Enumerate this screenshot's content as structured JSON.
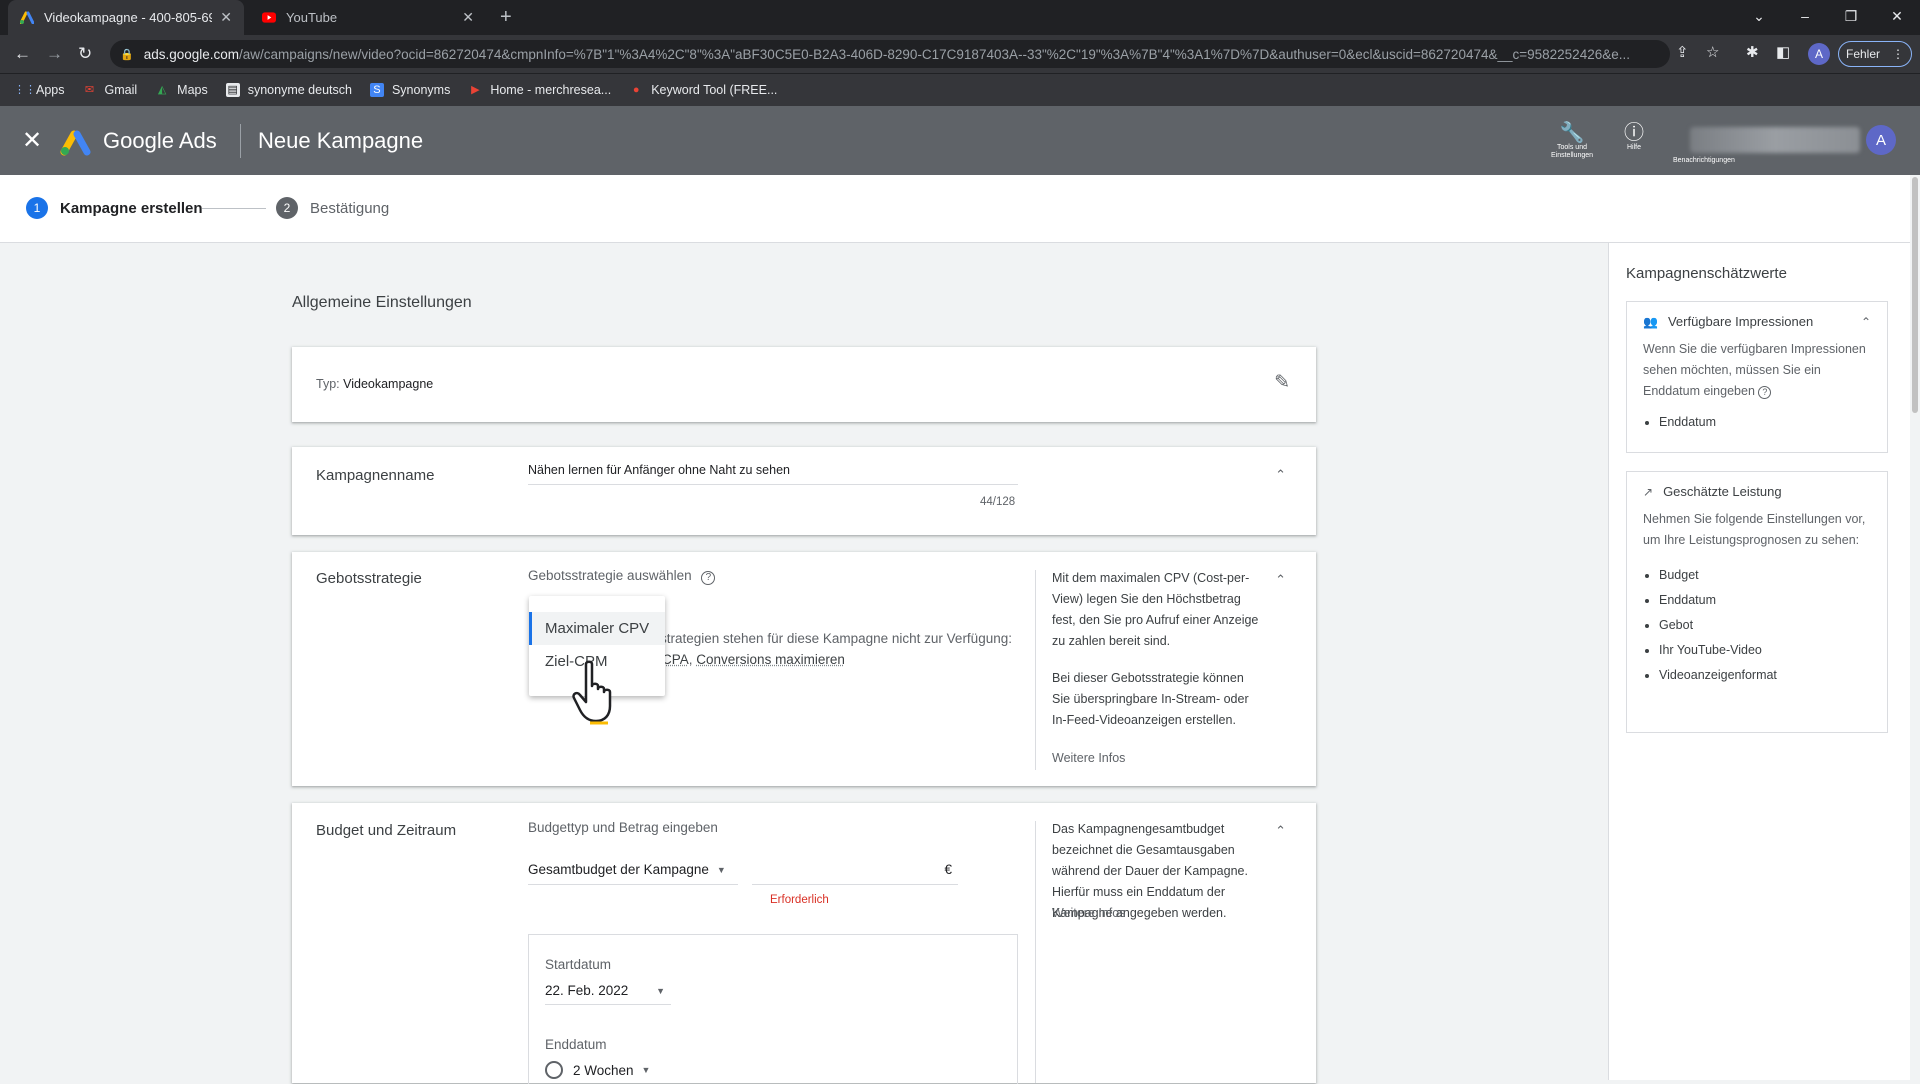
{
  "browser": {
    "tabs": [
      {
        "title": "Videokampagne - 400-805-6921",
        "close": "✕"
      },
      {
        "title": "YouTube",
        "close": "✕"
      }
    ],
    "new_tab": "+",
    "url_host": "ads.google.com",
    "url_path": "/aw/campaigns/new/video?ocid=862720474&cmpnInfo=%7B\"1\"%3A4%2C\"8\"%3A\"aBF30C5E0-B2A3-406D-8290-C17C9187403A--33\"%2C\"19\"%3A%7B\"4\"%3A1%7D%7D&authuser=0&ecl&uscid=862720474&__c=9582252426&e...",
    "profile_initial": "A",
    "error_chip": "Fehler",
    "bookmarks": [
      "Apps",
      "Gmail",
      "Maps",
      "synonyme deutsch",
      "Synonyms",
      "Home - merchresea...",
      "Keyword Tool (FREE..."
    ]
  },
  "ads_header": {
    "brand": "Google Ads",
    "page_title": "Neue Kampagne",
    "tools_label_1": "Tools und",
    "tools_label_2": "Einstellungen",
    "help_label": "Hilfe",
    "notifications_label": "Benachrichtigungen",
    "avatar_initial": "A"
  },
  "stepper": {
    "step1_num": "1",
    "step1_label": "Kampagne erstellen",
    "step2_num": "2",
    "step2_label": "Bestätigung"
  },
  "main": {
    "section_title": "Allgemeine Einstellungen",
    "type_label": "Typ:",
    "type_value": "Videokampagne",
    "name_label": "Kampagnenname",
    "name_value": "Nähen lernen für Anfänger ohne Naht zu sehen",
    "name_counter": "44/128",
    "bid_label": "Gebotsstrategie",
    "bid_select_prompt": "Gebotsstrategie auswählen",
    "bid_unavailable": "strategien stehen für diese Kampagne nicht zur Verfügung:",
    "bid_unavail_link1": "CPA",
    "bid_unavail_sep": ", ",
    "bid_unavail_link2": "Conversions maximieren",
    "dropdown_options": [
      "Maximaler CPV",
      "Ziel-CPM"
    ],
    "bid_info_1": "Mit dem maximalen CPV (Cost-per-View) legen Sie den Höchstbetrag fest, den Sie pro Aufruf einer Anzeige zu zahlen bereit sind.",
    "bid_info_2": "Bei dieser Gebotsstrategie können Sie überspringbare In-Stream- oder In-Feed-Videoanzeigen erstellen.",
    "bid_info_link": "Weitere Infos",
    "budget_label": "Budget und Zeitraum",
    "budget_prompt": "Budgettyp und Betrag eingeben",
    "budget_type": "Gesamtbudget der Kampagne",
    "currency": "€",
    "required": "Erforderlich",
    "start_label": "Startdatum",
    "start_value": "22. Feb. 2022",
    "end_label": "Enddatum",
    "end_value": "2 Wochen",
    "budget_info": "Das Kampagnengesamtbudget bezeichnet die Gesamtausgaben während der Dauer der Kampagne. Hierfür muss ein Enddatum der Kampagne angegeben werden.",
    "budget_info_link": "Weitere Infos"
  },
  "right_panel": {
    "title": "Kampagnenschätzwerte",
    "impressions_title": "Verfügbare Impressionen",
    "impressions_text": "Wenn Sie die verfügbaren Impressionen sehen möchten, müssen Sie ein Enddatum eingeben",
    "impressions_items": [
      "Enddatum"
    ],
    "perf_title": "Geschätzte Leistung",
    "perf_text": "Nehmen Sie folgende Einstellungen vor, um Ihre Leistungsprognosen zu sehen:",
    "perf_items": [
      "Budget",
      "Enddatum",
      "Gebot",
      "Ihr YouTube-Video",
      "Videoanzeigenformat"
    ]
  },
  "colors": {
    "accent": "#1a73e8",
    "header": "#5f6368",
    "error": "#d93025"
  }
}
